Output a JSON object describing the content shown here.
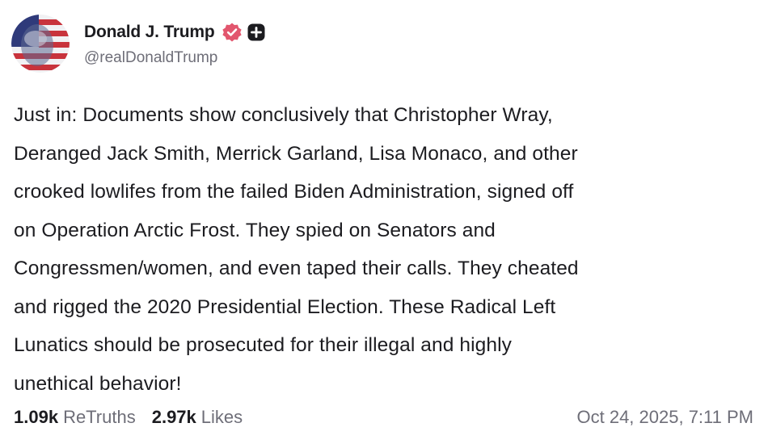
{
  "author": {
    "display_name": "Donald J. Trump",
    "handle": "@realDonaldTrump",
    "verified_icon": "verified-badge-icon",
    "plus_icon": "plus-badge-icon",
    "verified_color": "#e2566e"
  },
  "post": {
    "text": "Just in: Documents show conclusively that Christopher Wray,\nDeranged Jack Smith, Merrick Garland, Lisa Monaco, and other\ncrooked lowlifes from the failed Biden Administration, signed off\non Operation Arctic Frost. They spied on Senators and\nCongressmen/women, and even taped their calls. They cheated\nand rigged the 2020 Presidential Election. These Radical Left\nLunatics should be prosecuted for their illegal and highly\nunethical behavior!"
  },
  "stats": {
    "retruths_count": "1.09k",
    "retruths_label": "ReTruths",
    "likes_count": "2.97k",
    "likes_label": "Likes"
  },
  "timestamp": "Oct 24, 2025, 7:11 PM"
}
